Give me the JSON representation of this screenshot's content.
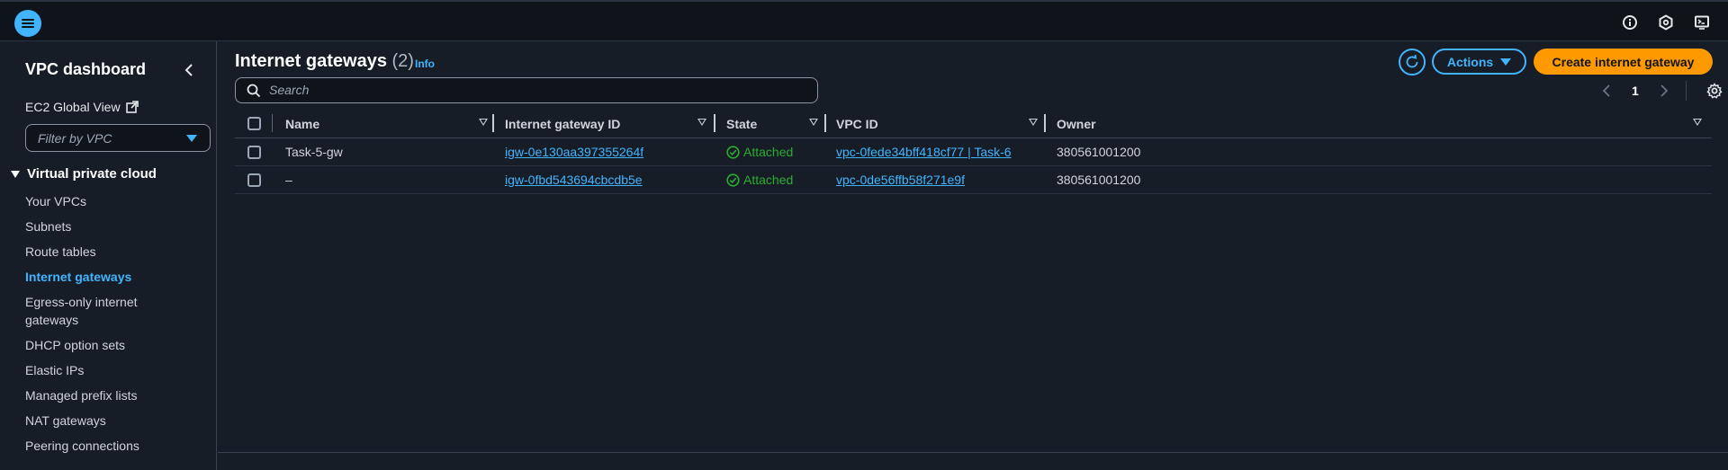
{
  "sidebar": {
    "title": "VPC dashboard",
    "ec2_global_view": "EC2 Global View",
    "filter_placeholder": "Filter by VPC",
    "section": "Virtual private cloud",
    "items": [
      {
        "label": "Your VPCs"
      },
      {
        "label": "Subnets"
      },
      {
        "label": "Route tables"
      },
      {
        "label": "Internet gateways"
      },
      {
        "label": "Egress-only internet gateways"
      },
      {
        "label": "DHCP option sets"
      },
      {
        "label": "Elastic IPs"
      },
      {
        "label": "Managed prefix lists"
      },
      {
        "label": "NAT gateways"
      },
      {
        "label": "Peering connections"
      }
    ]
  },
  "header": {
    "title": "Internet gateways",
    "count": "(2)",
    "info": "Info",
    "search_placeholder": "Search",
    "actions_label": "Actions",
    "create_label": "Create internet gateway",
    "page_number": "1"
  },
  "table": {
    "columns": [
      "Name",
      "Internet gateway ID",
      "State",
      "VPC ID",
      "Owner"
    ],
    "rows": [
      {
        "name": "Task-5-gw",
        "igw_id": "igw-0e130aa397355264f",
        "state": "Attached",
        "vpc_id": "vpc-0fede34bff418cf77 | Task-6",
        "owner": "380561001200"
      },
      {
        "name": "–",
        "igw_id": "igw-0fbd543694cbcdb5e",
        "state": "Attached",
        "vpc_id": "vpc-0de56ffb58f271e9f",
        "owner": "380561001200"
      }
    ]
  },
  "colors": {
    "accent": "#42b4ff",
    "primary_button": "#ff9900",
    "success": "#29ad32",
    "background": "#161d26"
  }
}
